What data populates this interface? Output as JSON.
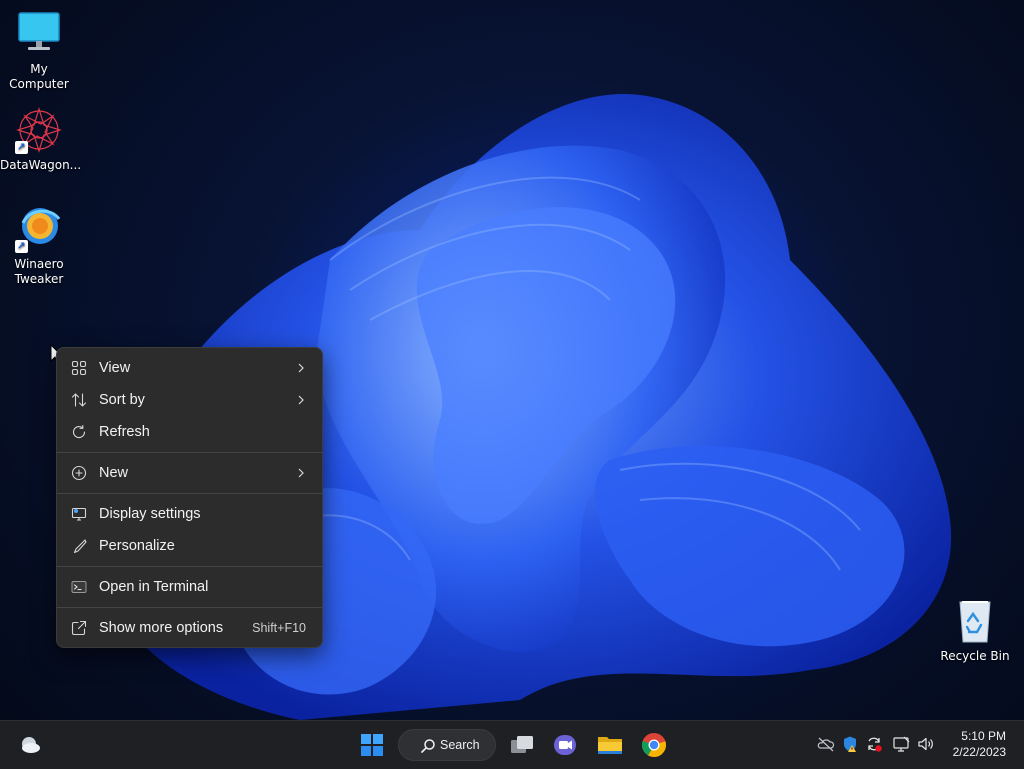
{
  "desktop": {
    "icons": [
      {
        "label": "My Computer"
      },
      {
        "label": "DataWagon..."
      },
      {
        "label": "Winaero Tweaker"
      },
      {
        "label": "Recycle Bin"
      }
    ]
  },
  "context_menu": {
    "items": [
      {
        "label": "View",
        "icon": "grid-icon",
        "has_submenu": true
      },
      {
        "label": "Sort by",
        "icon": "sort-icon",
        "has_submenu": true
      },
      {
        "label": "Refresh",
        "icon": "refresh-icon"
      },
      {
        "label": "New",
        "icon": "plus-circle-icon",
        "has_submenu": true
      },
      {
        "label": "Display settings",
        "icon": "display-icon"
      },
      {
        "label": "Personalize",
        "icon": "brush-icon"
      },
      {
        "label": "Open in Terminal",
        "icon": "terminal-icon"
      },
      {
        "label": "Show more options",
        "icon": "share-icon",
        "shortcut": "Shift+F10"
      }
    ]
  },
  "taskbar": {
    "search_label": "Search",
    "apps": [
      "start",
      "search",
      "task-view",
      "teams-chat",
      "file-explorer",
      "chrome"
    ],
    "tray": [
      "onedrive-icon",
      "defender-icon",
      "sync-icon",
      "network-icon",
      "volume-icon"
    ],
    "clock": {
      "time": "5:10 PM",
      "date": "2/22/2023"
    }
  },
  "colors": {
    "accent": "#1a5bd6",
    "menu_bg": "#2c2c2c",
    "taskbar_bg": "#1f2023"
  }
}
